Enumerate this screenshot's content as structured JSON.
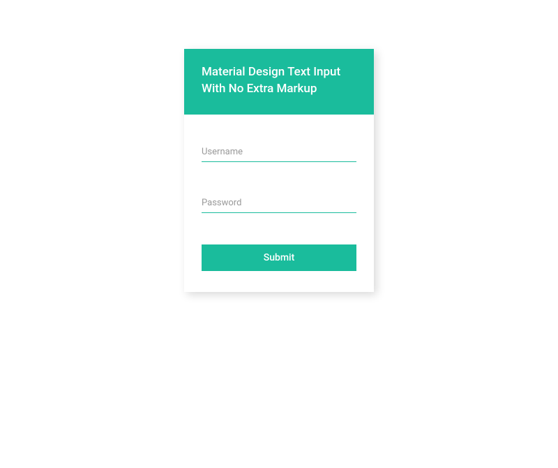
{
  "header": {
    "title": "Material Design Text Input With No Extra Markup"
  },
  "form": {
    "username": {
      "label": "Username",
      "value": ""
    },
    "password": {
      "label": "Password",
      "value": ""
    },
    "submit_label": "Submit"
  },
  "colors": {
    "accent": "#1abc9c"
  }
}
